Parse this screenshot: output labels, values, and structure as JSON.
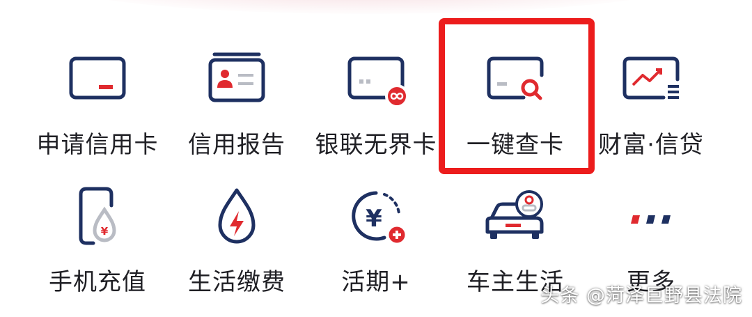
{
  "colors": {
    "navy": "#1e3061",
    "red": "#e02a2f",
    "grey": "#b9bcc4",
    "highlight": "#ec1c1c"
  },
  "menu": {
    "items": [
      {
        "label": "申请信用卡",
        "icon": "credit-card-apply-icon"
      },
      {
        "label": "信用报告",
        "icon": "id-card-report-icon"
      },
      {
        "label": "银联无界卡",
        "icon": "card-infinity-icon"
      },
      {
        "label": "一键查卡",
        "icon": "card-search-icon"
      },
      {
        "label": "财富·信贷",
        "icon": "wealth-chart-icon"
      },
      {
        "label": "手机充值",
        "icon": "phone-topup-icon"
      },
      {
        "label": "生活缴费",
        "icon": "utility-drop-icon"
      },
      {
        "label": "活期+",
        "icon": "yuan-plus-icon"
      },
      {
        "label": "车主生活",
        "icon": "car-owner-icon"
      },
      {
        "label": "更多",
        "icon": "more-dots-icon"
      }
    ]
  },
  "watermark": {
    "text": "头条 @菏泽巨野县法院"
  }
}
